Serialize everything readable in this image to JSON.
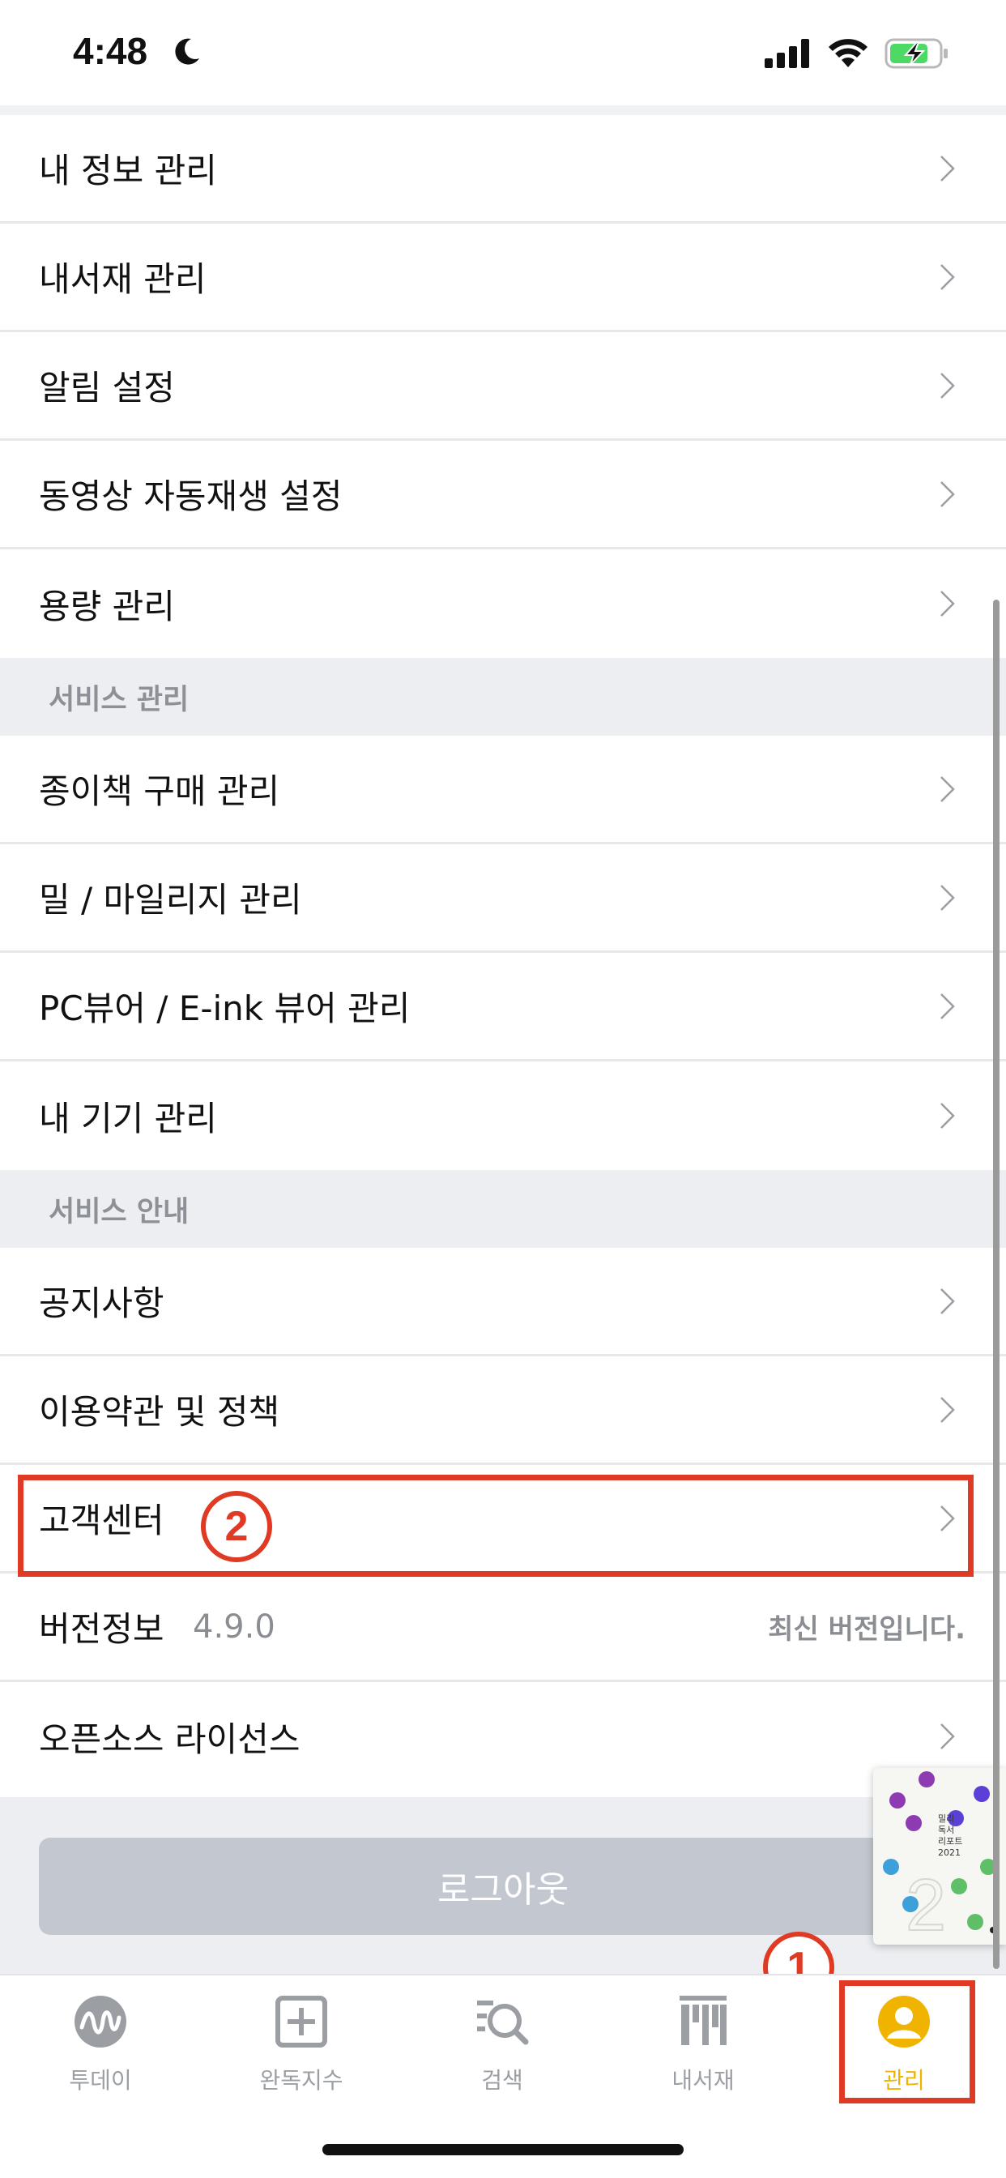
{
  "status_bar": {
    "time": "4:48"
  },
  "account_items": [
    {
      "label": "내 정보 관리"
    },
    {
      "label": "내서재 관리"
    },
    {
      "label": "알림 설정"
    },
    {
      "label": "동영상 자동재생 설정"
    },
    {
      "label": "용량 관리"
    }
  ],
  "service_manage": {
    "title": "서비스 관리",
    "items": [
      {
        "label": "종이책 구매 관리"
      },
      {
        "label": "밀 / 마일리지 관리"
      },
      {
        "label": "PC뷰어 / E-ink 뷰어 관리"
      },
      {
        "label": "내 기기 관리"
      }
    ]
  },
  "service_info": {
    "title": "서비스 안내",
    "items": [
      {
        "label": "공지사항"
      },
      {
        "label": "이용약관 및 정책"
      },
      {
        "label": "고객센터"
      }
    ],
    "version": {
      "label": "버전정보",
      "number": "4.9.0",
      "status": "최신 버전입니다."
    },
    "license": {
      "label": "오픈소스 라이선스"
    }
  },
  "annotations": {
    "step1": "1",
    "step2": "2",
    "color": "#e03a24"
  },
  "logout_label": "로그아웃",
  "report": {
    "text_lines": [
      "밀리",
      "독서",
      "리포트",
      "2021"
    ]
  },
  "tabs": [
    {
      "label": "투데이",
      "icon": "today-wave-icon"
    },
    {
      "label": "완독지수",
      "icon": "plus-square-icon"
    },
    {
      "label": "검색",
      "icon": "search-list-icon"
    },
    {
      "label": "내서재",
      "icon": "bookshelf-icon"
    },
    {
      "label": "관리",
      "icon": "profile-icon",
      "active": true
    }
  ],
  "colors": {
    "accent": "#f0b400",
    "inactive": "#9b9ea3",
    "section_bg": "#eceef1"
  }
}
